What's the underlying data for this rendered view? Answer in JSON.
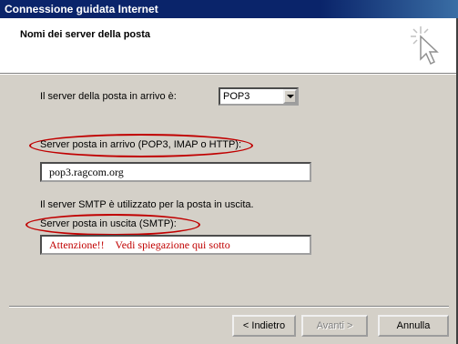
{
  "window": {
    "title": "Connessione guidata Internet"
  },
  "header": {
    "title": "Nomi dei server della posta",
    "icon": "wizard-star-cursor-icon"
  },
  "incoming_type": {
    "label": "Il server della posta in arrivo è:",
    "value": "POP3"
  },
  "incoming_server": {
    "label": "Server posta in arrivo (POP3, IMAP o HTTP):",
    "value": "pop3.ragcom.org"
  },
  "smtp_info": "Il server SMTP è utilizzato per la posta in uscita.",
  "outgoing_server": {
    "label": "Server posta in uscita (SMTP):",
    "value": "Attenzione!!    Vedi spiegazione qui sotto"
  },
  "buttons": {
    "back": "< Indietro",
    "next": "Avanti >",
    "cancel": "Annulla"
  },
  "colors": {
    "highlight": "#c00000",
    "warning_text": "#c00000"
  }
}
